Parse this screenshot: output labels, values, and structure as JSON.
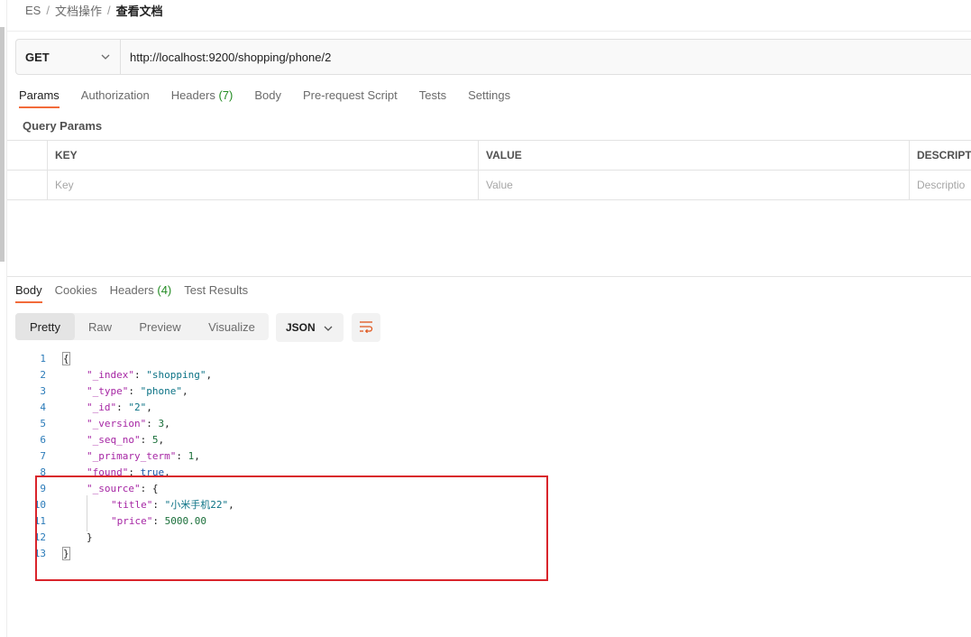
{
  "breadcrumb": {
    "items": [
      "ES",
      "文档操作"
    ],
    "current": "查看文档",
    "separator": "/"
  },
  "request": {
    "method": "GET",
    "url": "http://localhost:9200/shopping/phone/2"
  },
  "request_tabs": [
    {
      "label": "Params",
      "count": ""
    },
    {
      "label": "Authorization",
      "count": ""
    },
    {
      "label": "Headers",
      "count": "(7)"
    },
    {
      "label": "Body",
      "count": ""
    },
    {
      "label": "Pre-request Script",
      "count": ""
    },
    {
      "label": "Tests",
      "count": ""
    },
    {
      "label": "Settings",
      "count": ""
    }
  ],
  "query_params": {
    "title": "Query Params",
    "columns": [
      "KEY",
      "VALUE",
      "DESCRIPT"
    ],
    "placeholders": [
      "Key",
      "Value",
      "Descriptio"
    ]
  },
  "response_tabs": [
    {
      "label": "Body",
      "count": ""
    },
    {
      "label": "Cookies",
      "count": ""
    },
    {
      "label": "Headers",
      "count": "(4)"
    },
    {
      "label": "Test Results",
      "count": ""
    }
  ],
  "view_modes": [
    "Pretty",
    "Raw",
    "Preview",
    "Visualize"
  ],
  "format": "JSON",
  "response_body": [
    {
      "num": "1",
      "indent": 0,
      "parts": [
        [
          "pun",
          "{"
        ]
      ]
    },
    {
      "num": "2",
      "indent": 1,
      "parts": [
        [
          "k",
          "\"_index\""
        ],
        [
          "pun",
          ": "
        ],
        [
          "s",
          "\"shopping\""
        ],
        [
          "pun",
          ","
        ]
      ]
    },
    {
      "num": "3",
      "indent": 1,
      "parts": [
        [
          "k",
          "\"_type\""
        ],
        [
          "pun",
          ": "
        ],
        [
          "s",
          "\"phone\""
        ],
        [
          "pun",
          ","
        ]
      ]
    },
    {
      "num": "4",
      "indent": 1,
      "parts": [
        [
          "k",
          "\"_id\""
        ],
        [
          "pun",
          ": "
        ],
        [
          "s",
          "\"2\""
        ],
        [
          "pun",
          ","
        ]
      ]
    },
    {
      "num": "5",
      "indent": 1,
      "parts": [
        [
          "k",
          "\"_version\""
        ],
        [
          "pun",
          ": "
        ],
        [
          "n",
          "3"
        ],
        [
          "pun",
          ","
        ]
      ]
    },
    {
      "num": "6",
      "indent": 1,
      "parts": [
        [
          "k",
          "\"_seq_no\""
        ],
        [
          "pun",
          ": "
        ],
        [
          "n",
          "5"
        ],
        [
          "pun",
          ","
        ]
      ]
    },
    {
      "num": "7",
      "indent": 1,
      "parts": [
        [
          "k",
          "\"_primary_term\""
        ],
        [
          "pun",
          ": "
        ],
        [
          "n",
          "1"
        ],
        [
          "pun",
          ","
        ]
      ]
    },
    {
      "num": "8",
      "indent": 1,
      "parts": [
        [
          "k",
          "\"found\""
        ],
        [
          "pun",
          ": "
        ],
        [
          "b",
          "true"
        ],
        [
          "pun",
          ","
        ]
      ]
    },
    {
      "num": "9",
      "indent": 1,
      "parts": [
        [
          "k",
          "\"_source\""
        ],
        [
          "pun",
          ": {"
        ]
      ]
    },
    {
      "num": "10",
      "indent": 2,
      "parts": [
        [
          "k",
          "\"title\""
        ],
        [
          "pun",
          ": "
        ],
        [
          "s",
          "\"小米手机22\""
        ],
        [
          "pun",
          ","
        ]
      ]
    },
    {
      "num": "11",
      "indent": 2,
      "parts": [
        [
          "k",
          "\"price\""
        ],
        [
          "pun",
          ": "
        ],
        [
          "n",
          "5000.00"
        ]
      ]
    },
    {
      "num": "12",
      "indent": 1,
      "parts": [
        [
          "pun",
          "}"
        ]
      ]
    },
    {
      "num": "13",
      "indent": 0,
      "parts": [
        [
          "pun",
          "}"
        ]
      ]
    }
  ],
  "colors": {
    "accent": "#f26b3a",
    "highlight_box": "#d9242b",
    "count_green": "#228b22"
  }
}
